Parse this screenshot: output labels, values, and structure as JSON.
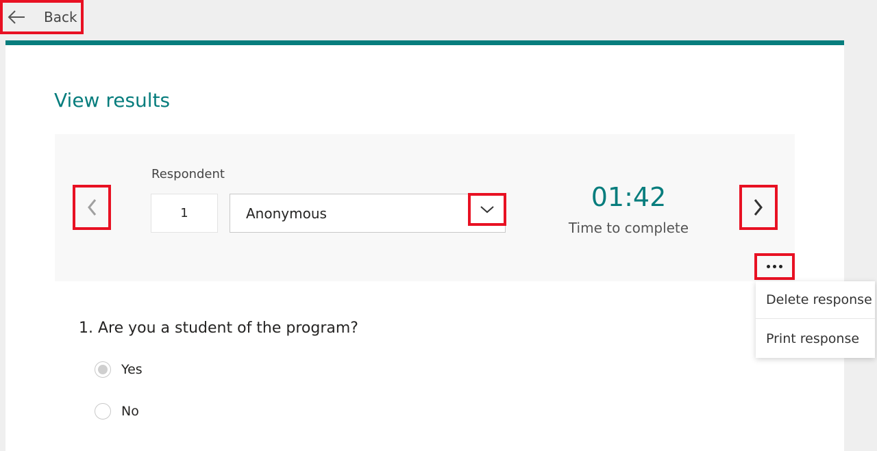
{
  "nav": {
    "back_label": "Back"
  },
  "page": {
    "title": "View results"
  },
  "respondent": {
    "label": "Respondent",
    "number": "1",
    "name": "Anonymous"
  },
  "time": {
    "value": "01:42",
    "label": "Time to complete"
  },
  "menu": {
    "items": [
      {
        "label": "Delete response"
      },
      {
        "label": "Print response"
      }
    ]
  },
  "question": {
    "text": "1. Are you a student of the program?",
    "options": [
      {
        "label": "Yes",
        "selected": true
      },
      {
        "label": "No",
        "selected": false
      }
    ]
  },
  "colors": {
    "accent": "#077d7d",
    "highlight": "#e81123"
  }
}
